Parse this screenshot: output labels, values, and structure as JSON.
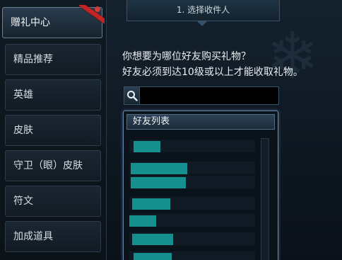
{
  "sidebar": {
    "items": [
      {
        "label": "赠礼中心",
        "active": true
      },
      {
        "label": "精品推荐"
      },
      {
        "label": "英雄"
      },
      {
        "label": "皮肤"
      },
      {
        "label": "守卫（眼）皮肤"
      },
      {
        "label": "符文"
      },
      {
        "label": "加成道具"
      }
    ]
  },
  "main": {
    "step_tab": "1. 选择收件人",
    "question": "你想要为哪位好友购买礼物？",
    "requirement": "好友必须到达10级或以上才能收取礼物。",
    "search": {
      "value": "",
      "icon": "magnifier-icon"
    },
    "friend_list": {
      "title": "好友列表",
      "rows": [
        {
          "name": ""
        },
        {
          "name": ""
        },
        {
          "name": ""
        },
        {
          "name": ""
        },
        {
          "name": ""
        },
        {
          "name": ""
        },
        {
          "name": ""
        }
      ]
    }
  },
  "colors": {
    "accent_ribbon": "#c42424",
    "name_highlight": "#16908e",
    "panel_border": "#6a86a8"
  }
}
